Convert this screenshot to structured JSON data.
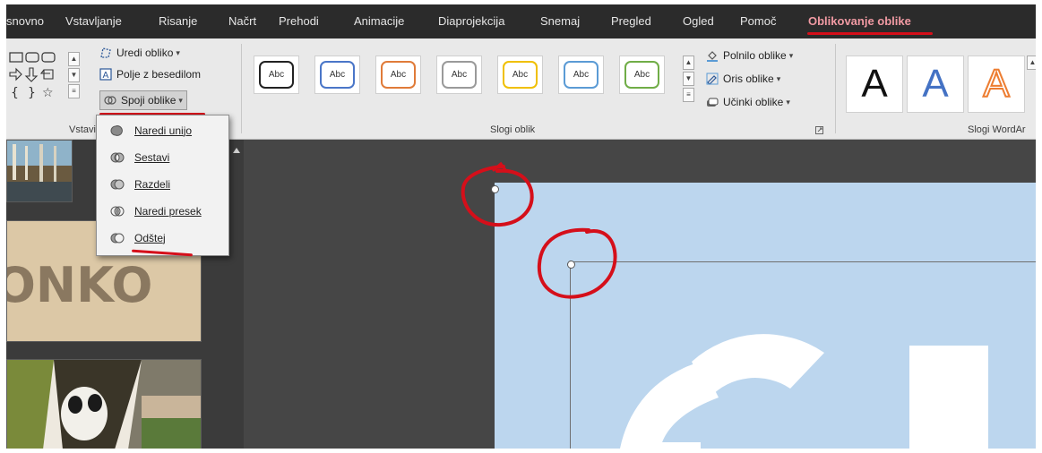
{
  "tabs": [
    {
      "label": "snovno"
    },
    {
      "label": "Vstavljanje"
    },
    {
      "label": "Risanje"
    },
    {
      "label": "Načrt"
    },
    {
      "label": "Prehodi"
    },
    {
      "label": "Animacije"
    },
    {
      "label": "Diaprojekcija"
    },
    {
      "label": "Snemaj"
    },
    {
      "label": "Pregled"
    },
    {
      "label": "Ogled"
    },
    {
      "label": "Pomoč"
    },
    {
      "label": "Oblikovanje oblike",
      "active": true
    }
  ],
  "ribbon": {
    "insert_shapes": {
      "edit_shape": "Uredi obliko",
      "text_box": "Polje z besedilom",
      "merge_shapes": "Spoji oblike",
      "group_label": "Vstavi ol"
    },
    "shape_styles": {
      "group_label": "Slogi oblik",
      "styles": [
        {
          "label": "Abc",
          "color": "#222222"
        },
        {
          "label": "Abc",
          "color": "#4a76c8"
        },
        {
          "label": "Abc",
          "color": "#e07b39"
        },
        {
          "label": "Abc",
          "color": "#9a9a9a"
        },
        {
          "label": "Abc",
          "color": "#f0c000"
        },
        {
          "label": "Abc",
          "color": "#5b9bd5"
        },
        {
          "label": "Abc",
          "color": "#70ad47"
        }
      ],
      "fill": "Polnilo oblike",
      "outline": "Oris oblike",
      "effects": "Učinki oblike"
    },
    "wordart": {
      "group_label": "Slogi WordAr",
      "letters": [
        {
          "label": "A",
          "color": "#111111"
        },
        {
          "label": "A",
          "color": "#4472c4"
        },
        {
          "label": "A",
          "color": "#ed7d31"
        }
      ]
    }
  },
  "merge_menu": {
    "items": [
      {
        "label": "Naredi unijo",
        "icon": "union-icon"
      },
      {
        "label": "Sestavi",
        "icon": "combine-icon"
      },
      {
        "label": "Razdeli",
        "icon": "fragment-icon"
      },
      {
        "label": "Naredi presek",
        "icon": "intersect-icon"
      },
      {
        "label": "Odštej",
        "icon": "subtract-icon"
      }
    ]
  },
  "thumbnails": {
    "slide2_text": "ONKO"
  },
  "colors": {
    "accent_tab": "#f19aa3",
    "annotation": "#d50f1a",
    "slide_background": "#bcd6ee"
  }
}
